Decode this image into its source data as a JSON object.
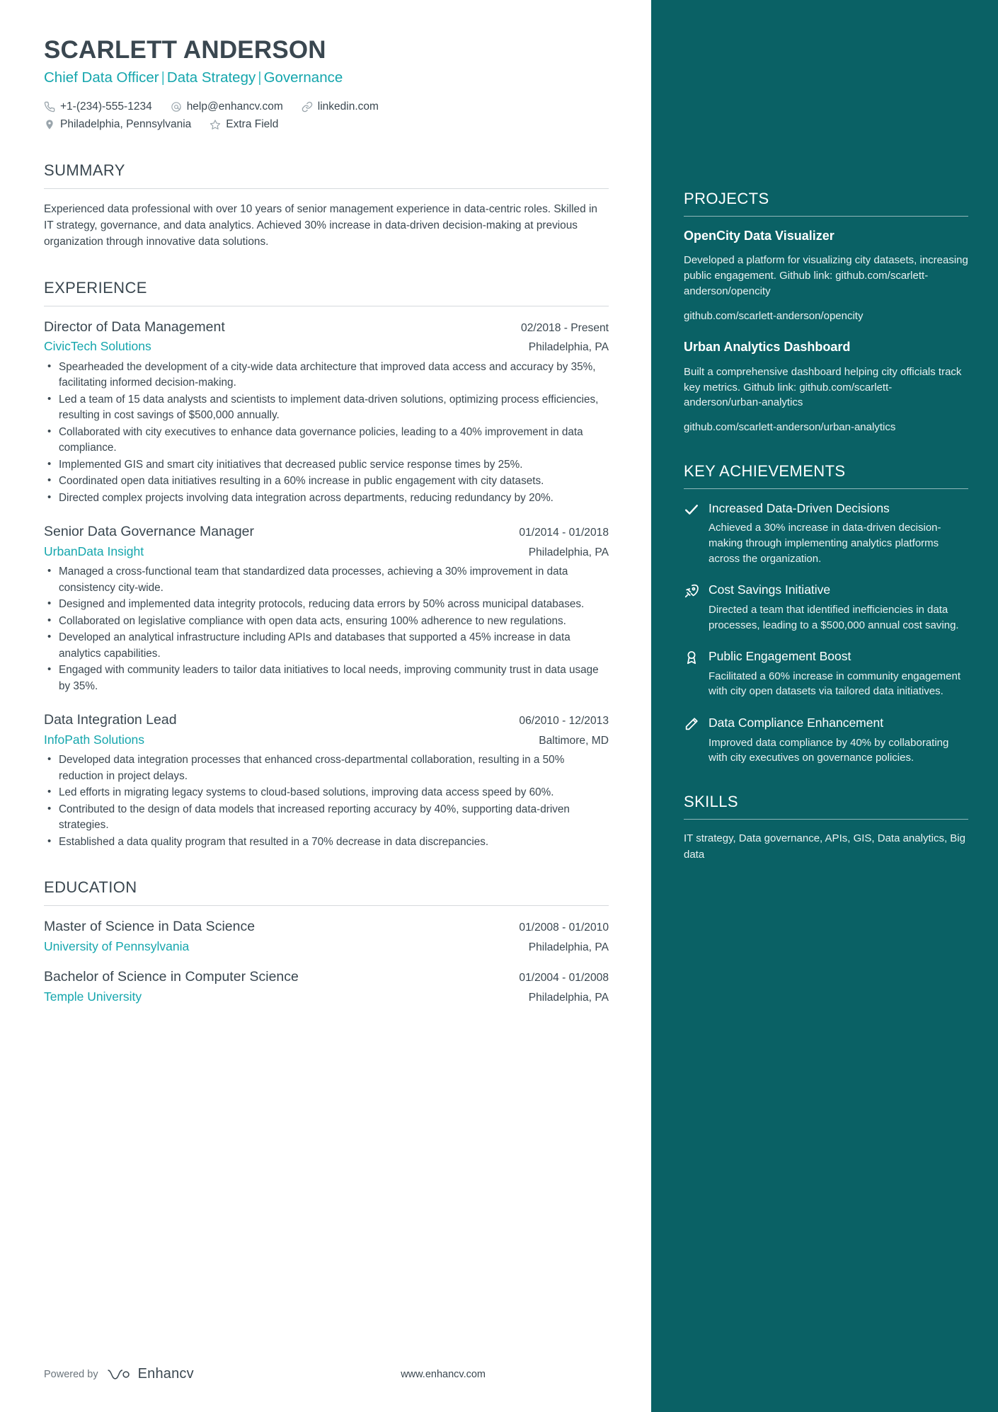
{
  "theme": {
    "sidebar_bg": "#0a6165",
    "accent": "#15a6ad",
    "text": "#3a4750"
  },
  "header": {
    "name": "SCARLETT ANDERSON",
    "headline_parts": [
      "Chief Data Officer",
      "Data Strategy",
      "Governance"
    ],
    "contacts_line1": [
      {
        "icon": "phone-icon",
        "text": "+1-(234)-555-1234"
      },
      {
        "icon": "email-icon",
        "text": "help@enhancv.com"
      },
      {
        "icon": "link-icon",
        "text": "linkedin.com"
      }
    ],
    "contacts_line2": [
      {
        "icon": "location-icon",
        "text": "Philadelphia, Pennsylvania"
      },
      {
        "icon": "star-icon",
        "text": "Extra Field"
      }
    ]
  },
  "summary": {
    "title": "SUMMARY",
    "text": "Experienced data professional with over 10 years of senior management experience in data-centric roles. Skilled in IT strategy, governance, and data analytics. Achieved 30% increase in data-driven decision-making at previous organization through innovative data solutions."
  },
  "experience": {
    "title": "EXPERIENCE",
    "entries": [
      {
        "role": "Director of Data Management",
        "date": "02/2018 - Present",
        "company": "CivicTech Solutions",
        "location": "Philadelphia, PA",
        "bullets": [
          "Spearheaded the development of a city-wide data architecture that improved data access and accuracy by 35%, facilitating informed decision-making.",
          "Led a team of 15 data analysts and scientists to implement data-driven solutions, optimizing process efficiencies, resulting in cost savings of $500,000 annually.",
          "Collaborated with city executives to enhance data governance policies, leading to a 40% improvement in data compliance.",
          "Implemented GIS and smart city initiatives that decreased public service response times by 25%.",
          "Coordinated open data initiatives resulting in a 60% increase in public engagement with city datasets.",
          "Directed complex projects involving data integration across departments, reducing redundancy by 20%."
        ]
      },
      {
        "role": "Senior Data Governance Manager",
        "date": "01/2014 - 01/2018",
        "company": "UrbanData Insight",
        "location": "Philadelphia, PA",
        "bullets": [
          "Managed a cross-functional team that standardized data processes, achieving a 30% improvement in data consistency city-wide.",
          "Designed and implemented data integrity protocols, reducing data errors by 50% across municipal databases.",
          "Collaborated on legislative compliance with open data acts, ensuring 100% adherence to new regulations.",
          "Developed an analytical infrastructure including APIs and databases that supported a 45% increase in data analytics capabilities.",
          "Engaged with community leaders to tailor data initiatives to local needs, improving community trust in data usage by 35%."
        ]
      },
      {
        "role": "Data Integration Lead",
        "date": "06/2010 - 12/2013",
        "company": "InfoPath Solutions",
        "location": "Baltimore, MD",
        "bullets": [
          "Developed data integration processes that enhanced cross-departmental collaboration, resulting in a 50% reduction in project delays.",
          "Led efforts in migrating legacy systems to cloud-based solutions, improving data access speed by 60%.",
          "Contributed to the design of data models that increased reporting accuracy by 40%, supporting data-driven strategies.",
          "Established a data quality program that resulted in a 70% decrease in data discrepancies."
        ]
      }
    ]
  },
  "education": {
    "title": "EDUCATION",
    "entries": [
      {
        "degree": "Master of Science in Data Science",
        "date": "01/2008 - 01/2010",
        "school": "University of Pennsylvania",
        "location": "Philadelphia, PA"
      },
      {
        "degree": "Bachelor of Science in Computer Science",
        "date": "01/2004 - 01/2008",
        "school": "Temple University",
        "location": "Philadelphia, PA"
      }
    ]
  },
  "projects": {
    "title": "PROJECTS",
    "items": [
      {
        "name": "OpenCity Data Visualizer",
        "description": "Developed a platform for visualizing city datasets, increasing public engagement. Github link: github.com/scarlett-anderson/opencity",
        "link": "github.com/scarlett-anderson/opencity"
      },
      {
        "name": "Urban Analytics Dashboard",
        "description": "Built a comprehensive dashboard helping city officials track key metrics. Github link: github.com/scarlett-anderson/urban-analytics",
        "link": "github.com/scarlett-anderson/urban-analytics"
      }
    ]
  },
  "key_achievements": {
    "title": "KEY ACHIEVEMENTS",
    "items": [
      {
        "icon": "check-icon",
        "title": "Increased Data-Driven Decisions",
        "description": "Achieved a 30% increase in data-driven decision-making through implementing analytics platforms across the organization."
      },
      {
        "icon": "rocket-icon",
        "title": "Cost Savings Initiative",
        "description": "Directed a team that identified inefficiencies in data processes, leading to a $500,000 annual cost saving."
      },
      {
        "icon": "award-icon",
        "title": "Public Engagement Boost",
        "description": "Facilitated a 60% increase in community engagement with city open datasets via tailored data initiatives."
      },
      {
        "icon": "pen-icon",
        "title": "Data Compliance Enhancement",
        "description": "Improved data compliance by 40% by collaborating with city executives on governance policies."
      }
    ]
  },
  "skills": {
    "title": "SKILLS",
    "text": "IT strategy, Data governance, APIs, GIS, Data analytics, Big data"
  },
  "footer": {
    "powered_by": "Powered by",
    "brand": "Enhancv",
    "website": "www.enhancv.com"
  }
}
